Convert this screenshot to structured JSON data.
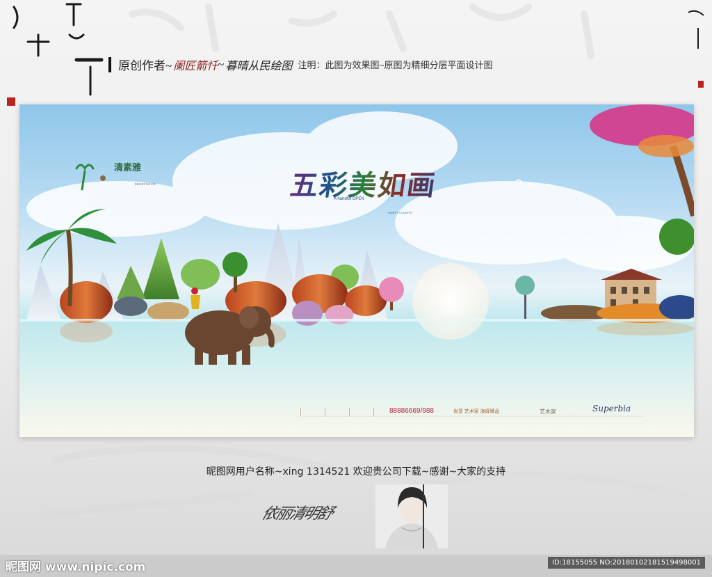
{
  "header": {
    "prefix": "原创作者~",
    "brand": "阑匠箭忏",
    "separator": "~",
    "brand2": "暮晴从民绘图",
    "note": "注明：此图为效果图~原图为精细分层平面设计图"
  },
  "banner": {
    "logo_name": "清素雅",
    "logo_sub": "BRIGHT ESTATE",
    "title": "五彩美如画",
    "subtitle": "A handful OPEN",
    "subtitle2": "INDEPT COUNTRY",
    "phone": "88886669/988",
    "slogan": "尚意 艺术家 演绎臻品",
    "brand_cn": "艺木家",
    "brand_script": "Superbia"
  },
  "credit": {
    "text": "昵图网用户名称~xing 1314521 欢迎贵公司下载~感谢~大家的支持"
  },
  "signature": "依丽清明舒",
  "footer": {
    "site": "昵图网 www.nipic.com",
    "id": "ID:18155055 NO:20180102181519498001"
  },
  "colors": {
    "sky": "#8fc6ea",
    "water": "#bfe8ee",
    "accent": "#b0243a",
    "brand_red": "#8b1d1d"
  }
}
